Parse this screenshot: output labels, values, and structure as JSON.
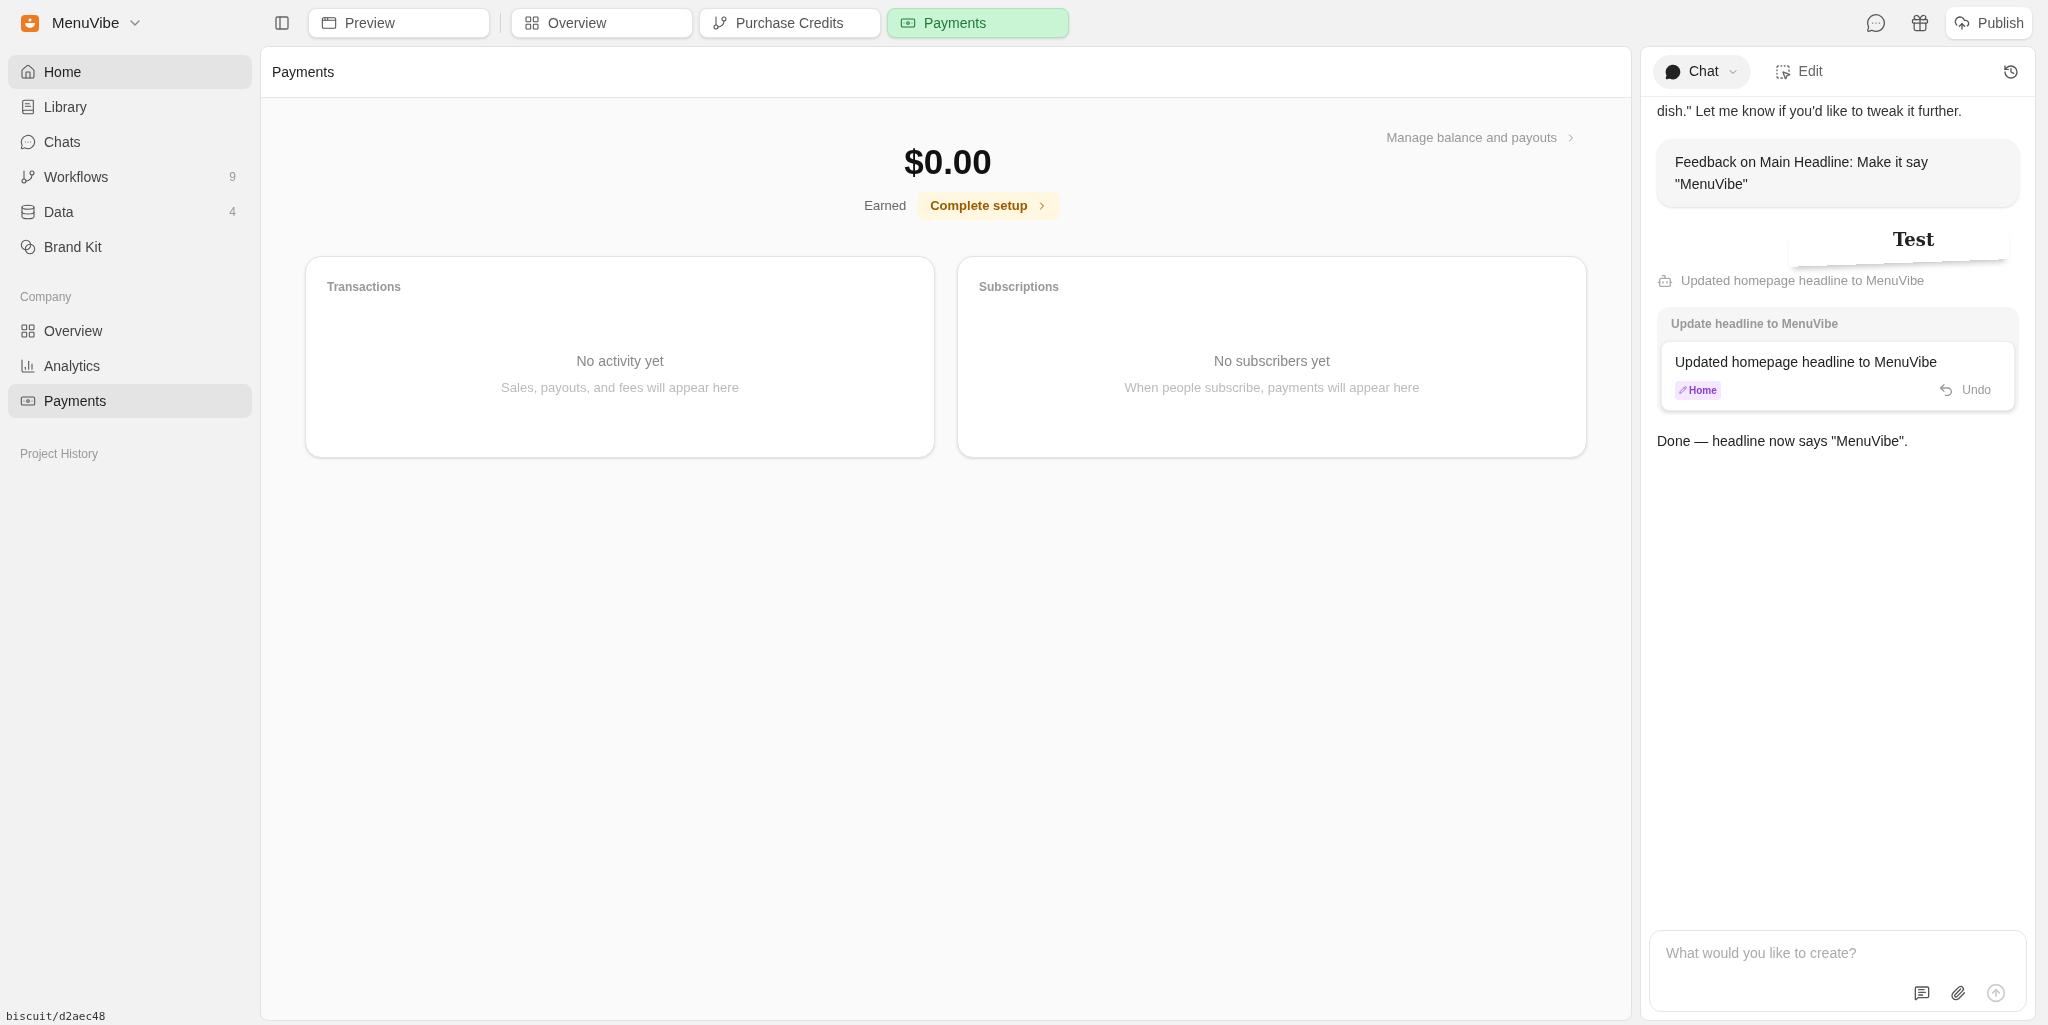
{
  "app": {
    "name": "MenuVibe"
  },
  "tabs": [
    {
      "label": "Preview",
      "kind": "preview",
      "selected": false
    },
    {
      "label": "Overview",
      "kind": "grid",
      "selected": false
    },
    {
      "label": "Purchase Credits",
      "kind": "branch",
      "selected": false
    },
    {
      "label": "Payments",
      "kind": "money",
      "selected": true
    }
  ],
  "publish_button": "Publish",
  "sidebar": {
    "items": [
      {
        "label": "Home",
        "kind": "home",
        "selected": true
      },
      {
        "label": "Library",
        "kind": "book",
        "selected": false
      },
      {
        "label": "Chats",
        "kind": "chat",
        "selected": false
      },
      {
        "label": "Workflows",
        "kind": "branch",
        "count": "9",
        "selected": false
      },
      {
        "label": "Data",
        "kind": "data",
        "count": "4",
        "selected": false
      },
      {
        "label": "Brand Kit",
        "kind": "blend",
        "selected": false
      }
    ],
    "company_heading": "Company",
    "company_items": [
      {
        "label": "Overview",
        "kind": "grid",
        "selected": false
      },
      {
        "label": "Analytics",
        "kind": "chart",
        "selected": false
      },
      {
        "label": "Payments",
        "kind": "money",
        "selected": true
      }
    ],
    "history_heading": "Project History"
  },
  "main": {
    "title": "Payments",
    "manage_link": "Manage balance and payouts",
    "amount": "$0.00",
    "amount_label": "Earned",
    "setup_button": "Complete setup",
    "cards": [
      {
        "title": "Transactions",
        "empty_title": "No activity yet",
        "empty_text": "Sales, payouts, and fees will appear here"
      },
      {
        "title": "Subscriptions",
        "empty_title": "No subscribers yet",
        "empty_text": "When people subscribe, payments will appear here"
      }
    ]
  },
  "chat": {
    "tabs": [
      {
        "label": "Chat",
        "selected": true
      },
      {
        "label": "Edit",
        "selected": false
      }
    ],
    "cut_message": "dish.\" Let me know if you'd like to tweak it further.",
    "user_message": "Feedback on Main Headline: Make it say \"MenuVibe\"",
    "thumbnail_text": "Test",
    "status": "Updated homepage headline to MenuVibe",
    "change_card": {
      "heading": "Update headline to MenuVibe",
      "title": "Updated homepage headline to MenuVibe",
      "tag": "Home",
      "undo": "Undo"
    },
    "reply": "Done — headline now says \"MenuVibe\".",
    "input_placeholder": "What would you like to create?"
  },
  "footer_label": "biscuit/d2aec48"
}
